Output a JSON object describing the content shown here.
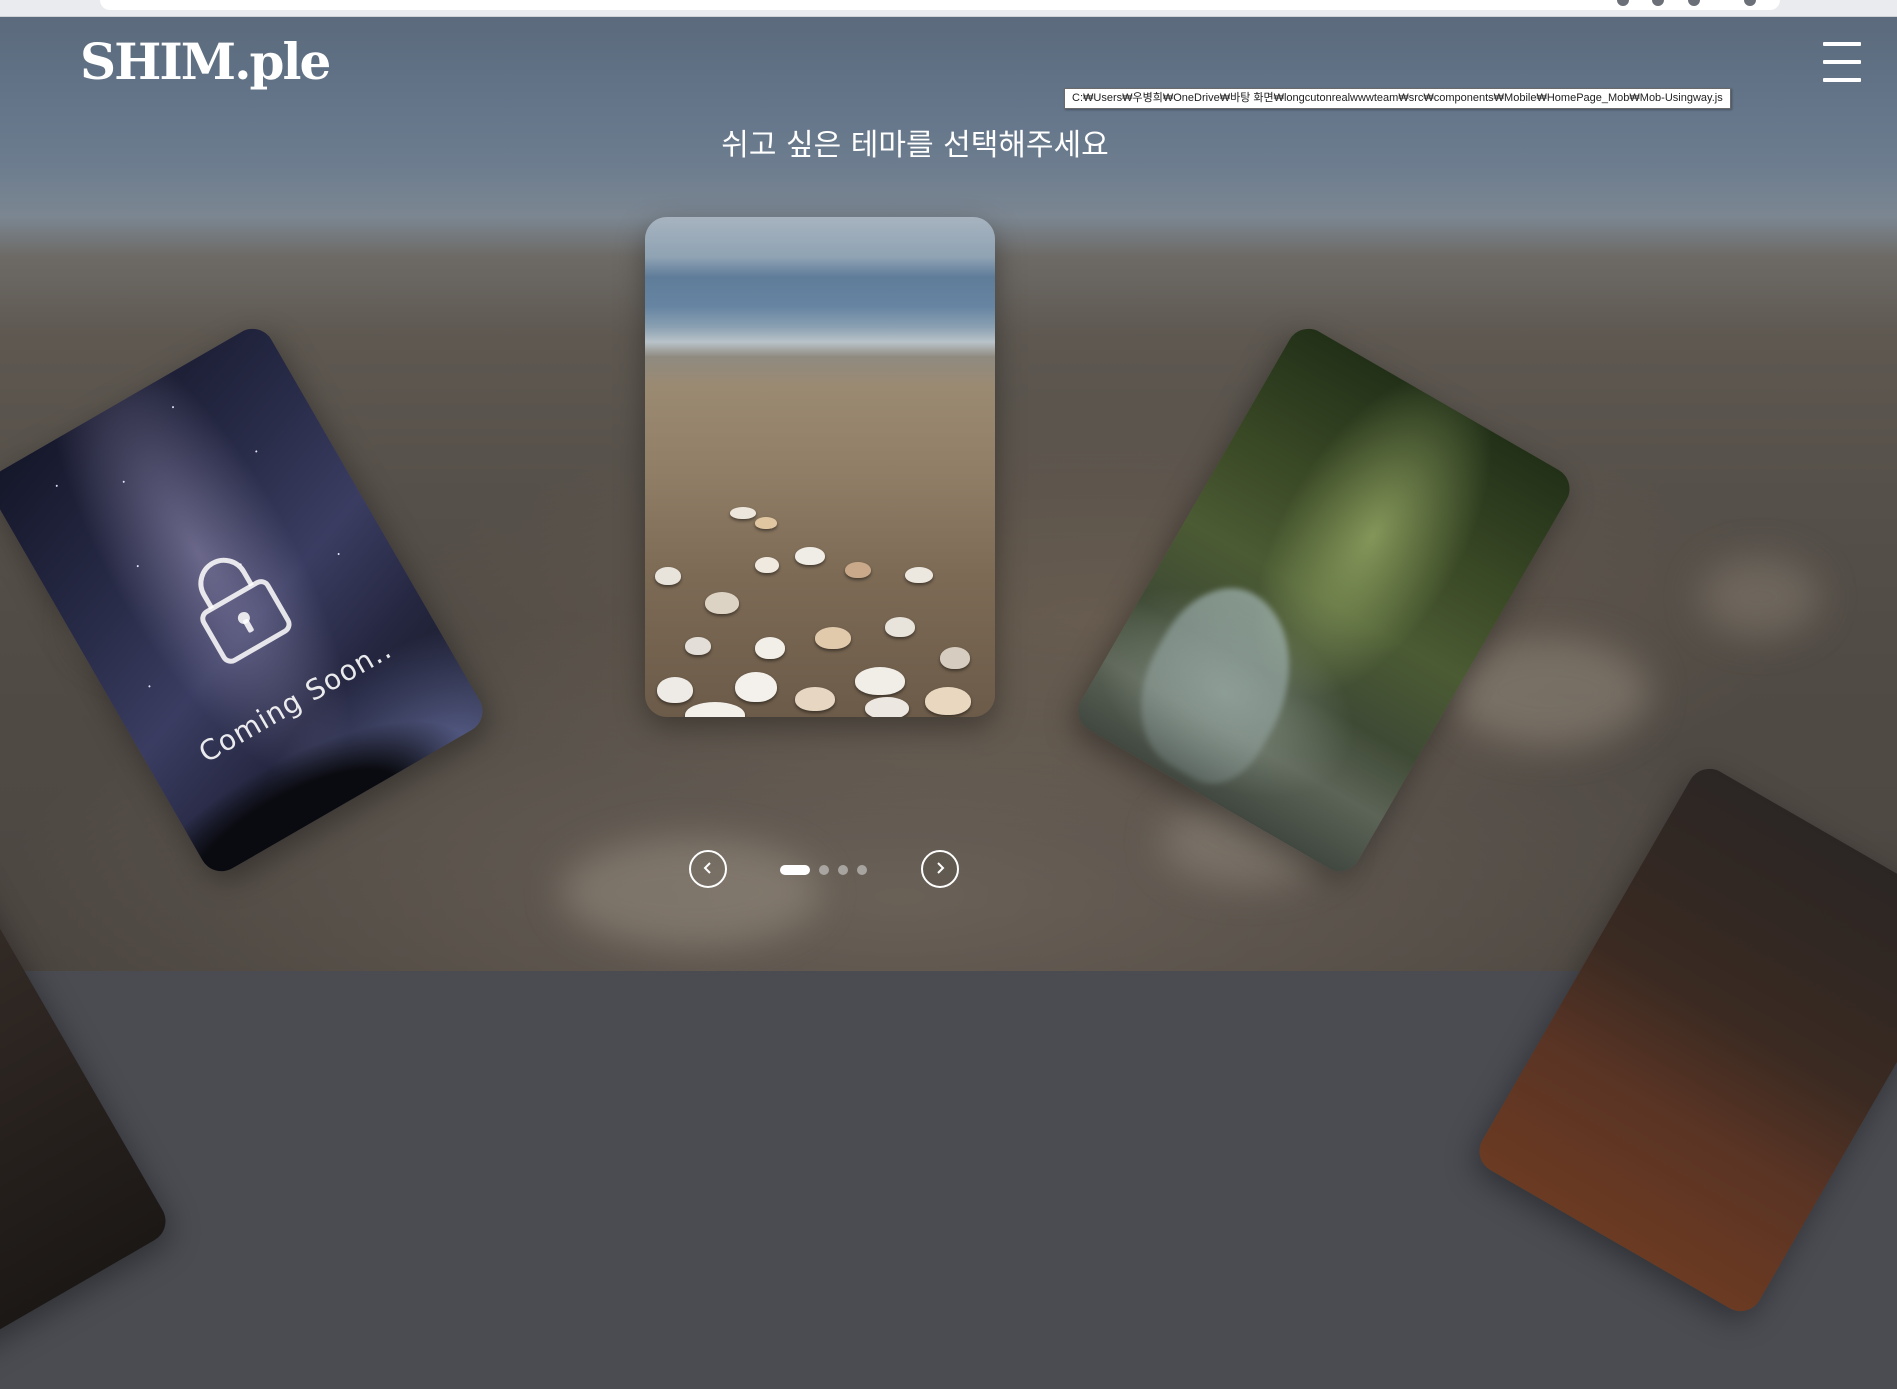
{
  "header": {
    "logo_text": "SHIM.ple",
    "menu_icon": "hamburger-menu-icon"
  },
  "tooltip": {
    "text": "C:₩Users₩우병희₩OneDrive₩바탕 화면₩longcutonrealwwwteam₩src₩components₩Mobile₩HomePage_Mob₩Mob-Usingway.js"
  },
  "main": {
    "heading": "쉬고 싶은 테마를 선택해주세요"
  },
  "carousel": {
    "cards": [
      {
        "theme": "night-sky",
        "locked": true,
        "label": "Coming Soon..",
        "icon": "lock-icon"
      },
      {
        "theme": "beach-seashells",
        "locked": false
      },
      {
        "theme": "forest-stream",
        "locked": false
      }
    ],
    "indicator": {
      "count": 4,
      "active_index": 0
    },
    "prev_icon": "chevron-left-icon",
    "next_icon": "chevron-right-icon"
  },
  "colors": {
    "text": "#ffffff",
    "dot_active": "#ffffff",
    "dot_inactive": "#c8c8c8"
  }
}
